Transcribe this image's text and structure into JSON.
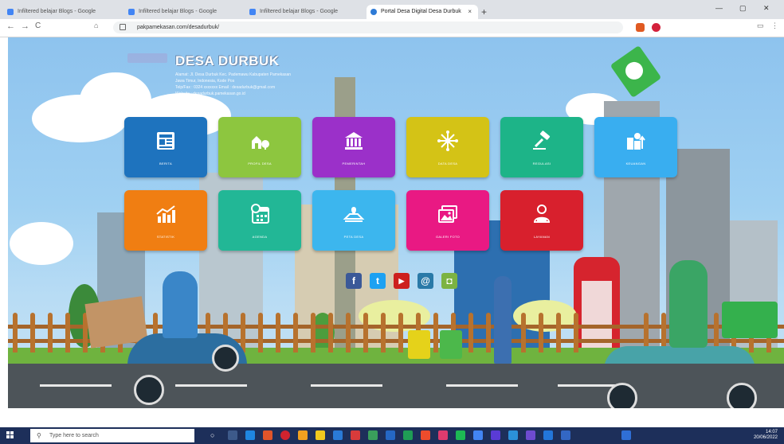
{
  "browser": {
    "tabs": [
      {
        "label": "Infiltered belajar Blogs - Google"
      },
      {
        "label": "Infiltered belajar Blogs - Google"
      },
      {
        "label": "Infiltered belajar Blogs - Google"
      },
      {
        "label": "Portal Desa Digital Desa Durbuk"
      }
    ],
    "url": "pakpamekasan.com/desadurbuk/",
    "new_tab": "+",
    "close": "×",
    "back": "←",
    "forward": "→",
    "reload": "C"
  },
  "site": {
    "title": "DESA DURBUK",
    "sublines": [
      "Alamat: Jl. Desa Durbuk Kec. Pademawu Kabupaten Pamekasan",
      "Jawa Timur, Indonesia, Kode Pos",
      "Telp/Fax : 0324 xxxxxxx  Email : desadurbuk@gmail.com",
      "Website : desadurbuk.pamekasan.go.id"
    ]
  },
  "tiles": [
    {
      "label": "BERITA",
      "color": "#1e73be",
      "icon": "newspaper-icon"
    },
    {
      "label": "PROFIL DESA",
      "color": "#8dc63f",
      "icon": "village-icon"
    },
    {
      "label": "PEMERINTAH",
      "color": "#9b30c9",
      "icon": "government-icon"
    },
    {
      "label": "DATA DESA",
      "color": "#d4c316",
      "icon": "data-icon"
    },
    {
      "label": "REGULASI",
      "color": "#1db488",
      "icon": "gavel-icon"
    },
    {
      "label": "KEUANGAN",
      "color": "#39aef0",
      "icon": "finance-icon"
    },
    {
      "label": "STATISTIK",
      "color": "#f07e12",
      "icon": "chart-icon"
    },
    {
      "label": "AGENDA",
      "color": "#22b796",
      "icon": "calendar-icon"
    },
    {
      "label": "PETA DESA",
      "color": "#3cb6ee",
      "icon": "map-icon"
    },
    {
      "label": "GALERI FOTO",
      "color": "#e91983",
      "icon": "gallery-icon"
    },
    {
      "label": "LAYANAN",
      "color": "#d8202d",
      "icon": "service-icon"
    }
  ],
  "social": [
    {
      "name": "facebook",
      "glyph": "f",
      "color": "#3b5998"
    },
    {
      "name": "twitter",
      "glyph": "t",
      "color": "#1da1f2"
    },
    {
      "name": "youtube",
      "glyph": "▶",
      "color": "#cd201f"
    },
    {
      "name": "email",
      "glyph": "@",
      "color": "#2a7aa8"
    },
    {
      "name": "android",
      "glyph": "◘",
      "color": "#7cb342"
    }
  ],
  "taskbar": {
    "search_placeholder": "Type here to search",
    "time": "14:07",
    "date": "20/06/2022"
  }
}
